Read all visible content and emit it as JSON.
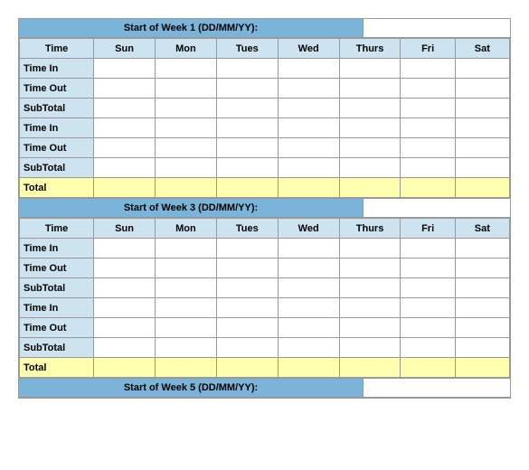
{
  "weeks": [
    {
      "header": "Start of Week 1 (DD/MM/YY):",
      "id": "week1"
    },
    {
      "header": "Start of Week 3 (DD/MM/YY):",
      "id": "week3"
    },
    {
      "header": "Start of Week 5 (DD/MM/YY):",
      "id": "week5"
    }
  ],
  "columns": {
    "time": "Time",
    "sun": "Sun",
    "mon": "Mon",
    "tues": "Tues",
    "wed": "Wed",
    "thurs": "Thurs",
    "fri": "Fri",
    "sat": "Sat"
  },
  "rows": [
    "Time In",
    "Time Out",
    "SubTotal",
    "Time In",
    "Time Out",
    "SubTotal"
  ],
  "total_label": "Total"
}
